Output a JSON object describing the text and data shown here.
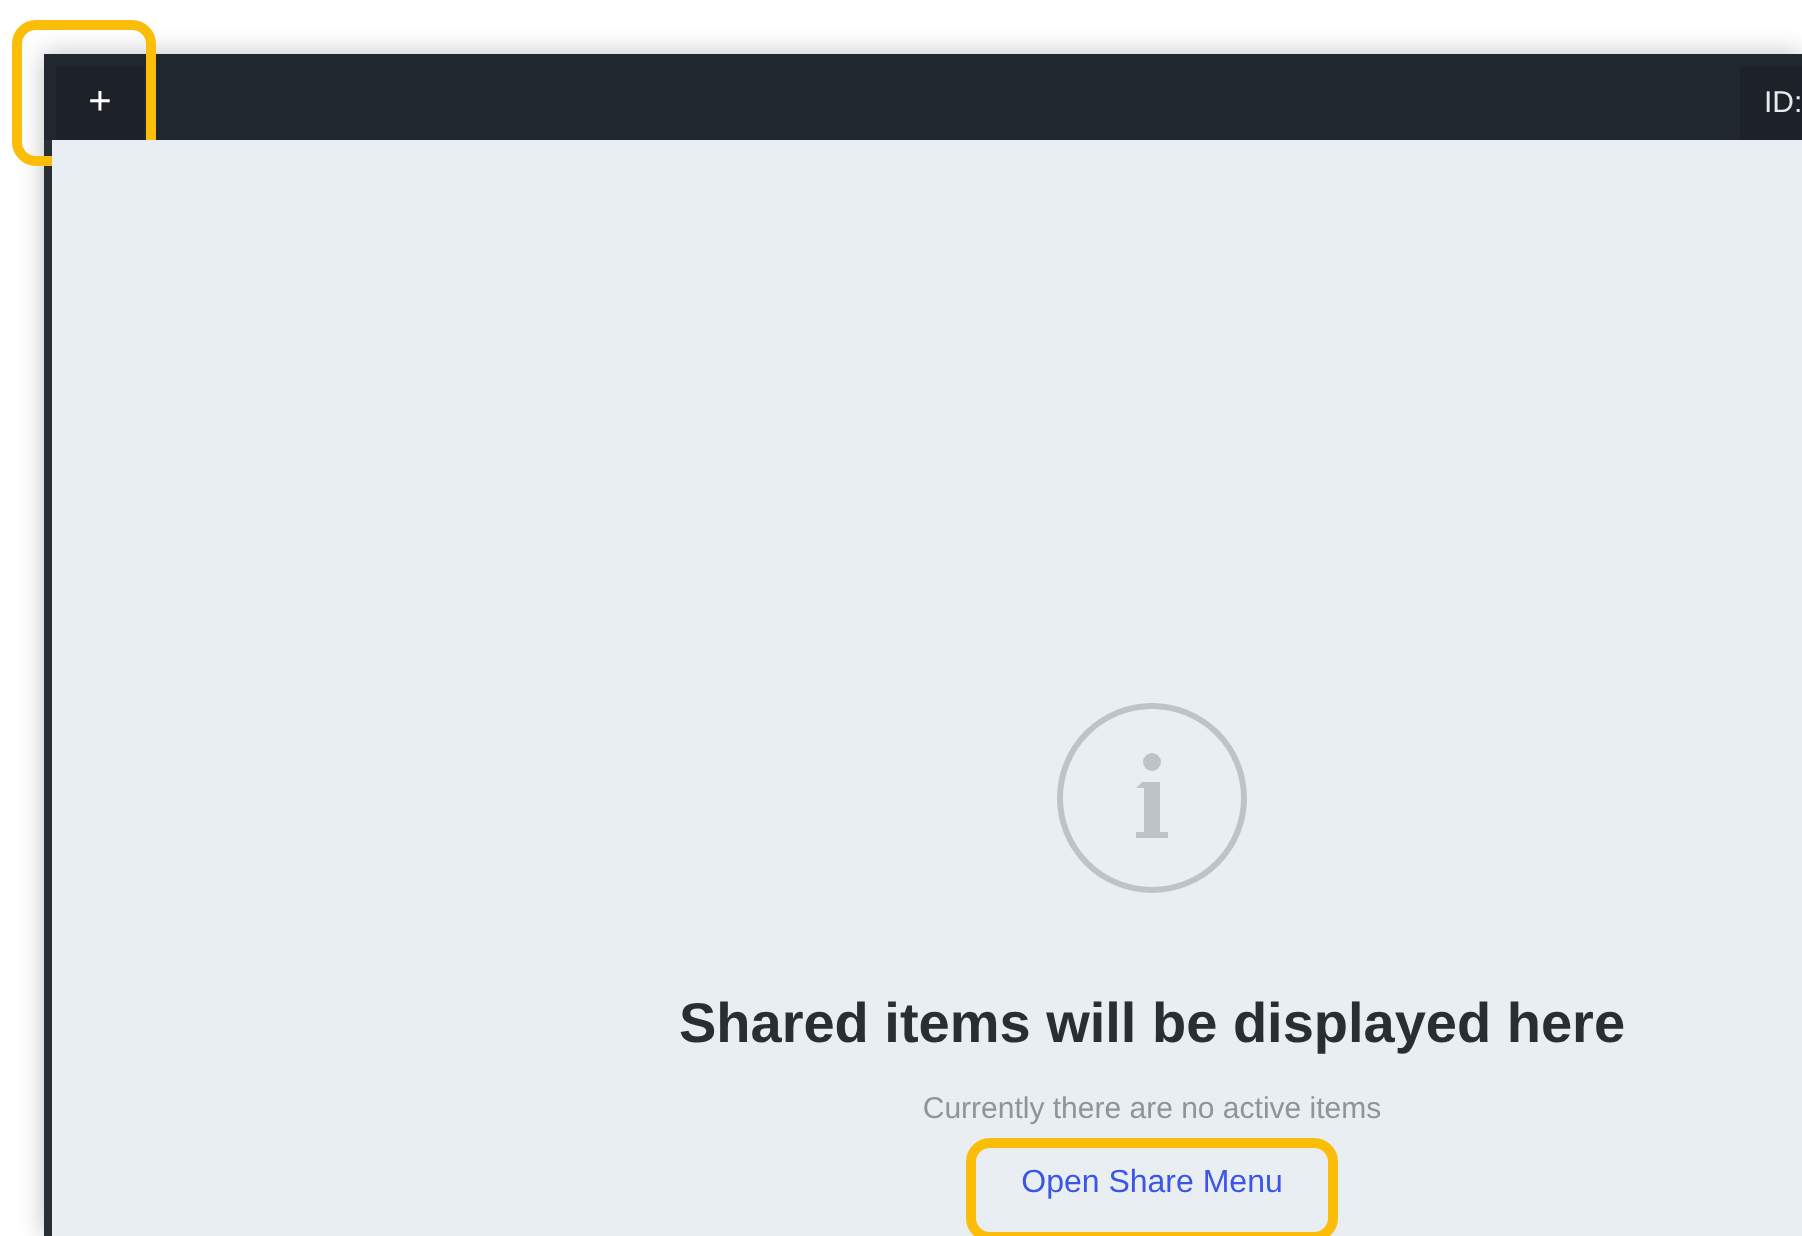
{
  "header": {
    "add_button": {
      "label": "+",
      "highlighted": true
    },
    "id_label": "ID:"
  },
  "empty_state": {
    "title": "Shared items will be displayed here",
    "subtitle": "Currently there are no active items",
    "link": {
      "label": "Open Share Menu",
      "highlighted": true
    }
  }
}
